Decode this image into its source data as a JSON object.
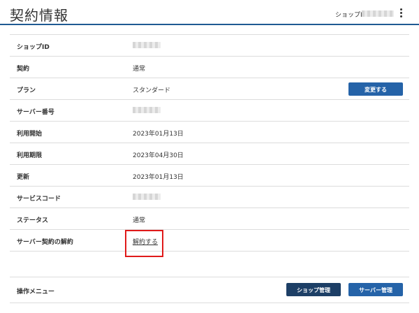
{
  "header": {
    "title": "契約情報",
    "shop_id_label": "ショップID"
  },
  "contract": {
    "rows": [
      {
        "label": "ショップID",
        "value": ""
      },
      {
        "label": "契約",
        "value": "通常"
      },
      {
        "label": "プラン",
        "value": "スタンダード"
      },
      {
        "label": "サーバー番号",
        "value": ""
      },
      {
        "label": "利用開始",
        "value": "2023年01月13日"
      },
      {
        "label": "利用期限",
        "value": "2023年04月30日"
      },
      {
        "label": "更新",
        "value": "2023年01月13日"
      },
      {
        "label": "サービスコード",
        "value": ""
      },
      {
        "label": "ステータス",
        "value": "通常"
      },
      {
        "label": "サーバー契約の解約",
        "value": "解約する"
      }
    ],
    "change_plan_button": "変更する"
  },
  "menu": {
    "label": "操作メニュー",
    "shop_management_button": "ショップ管理",
    "server_management_button": "サーバー管理"
  },
  "colors": {
    "accent": "#1f5a93",
    "button_blue": "#2563a8",
    "button_dark": "#1d3f66",
    "highlight": "#e01a1a"
  }
}
